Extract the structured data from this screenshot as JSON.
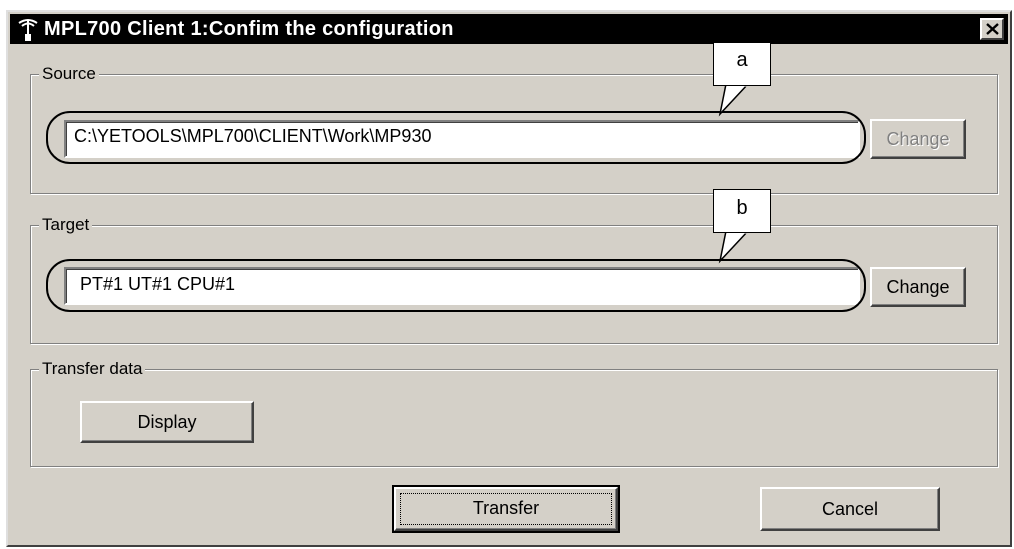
{
  "window": {
    "title": "MPL700 Client  1:Confim the configuration",
    "app_icon": "antenna-icon",
    "close_icon": "close-icon"
  },
  "source": {
    "label": "Source",
    "path_value": "C:\\YETOOLS\\MPL700\\CLIENT\\Work\\MP930",
    "change_label": "Change",
    "change_enabled": false
  },
  "target": {
    "label": "Target",
    "value": "PT#1  UT#1  CPU#1",
    "change_label": "Change"
  },
  "transfer_data": {
    "label": "Transfer data",
    "display_label": "Display"
  },
  "footer": {
    "transfer_label": "Transfer",
    "cancel_label": "Cancel"
  },
  "annotations": {
    "a": "a",
    "b": "b"
  }
}
